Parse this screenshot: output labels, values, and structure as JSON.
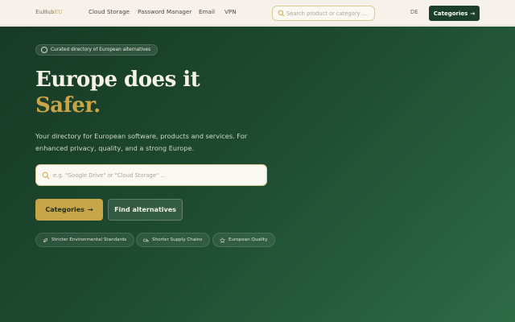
{
  "header": {
    "logo_text": "EuHub",
    "logo_accent": "EU",
    "nav_links": [
      "Cloud Storage",
      "Password Manager",
      "Email",
      "VPN"
    ],
    "search_placeholder": "Search product or category ...",
    "language": "DE",
    "cta_label": "Categories",
    "cta_arrow": "→"
  },
  "hero": {
    "badge": "Curated directory of European alternatives",
    "headline": "Europe does it",
    "headline_accent": "Safer.",
    "subtitle": "Your directory for European software, products and services. For enhanced privacy, quality, and a strong Europe.",
    "search_placeholder": "e.g. \"Google Drive\" or \"Cloud Storage\" ...",
    "primary_button": "Categories",
    "primary_arrow": "→",
    "secondary_button": "Find alternatives",
    "chips": [
      {
        "label": "Stricter Environmental Standards",
        "icon": "leaf-icon"
      },
      {
        "label": "Shorter Supply Chains",
        "icon": "truck-icon"
      },
      {
        "label": "European Quality",
        "icon": "star-icon"
      }
    ]
  },
  "colors": {
    "nav_bg": "#f6f1ea",
    "hero_dark": "#173a26",
    "hero_light": "#2c6b45",
    "accent_gold": "#c9a54a",
    "cta_dark": "#1b3f2b"
  }
}
